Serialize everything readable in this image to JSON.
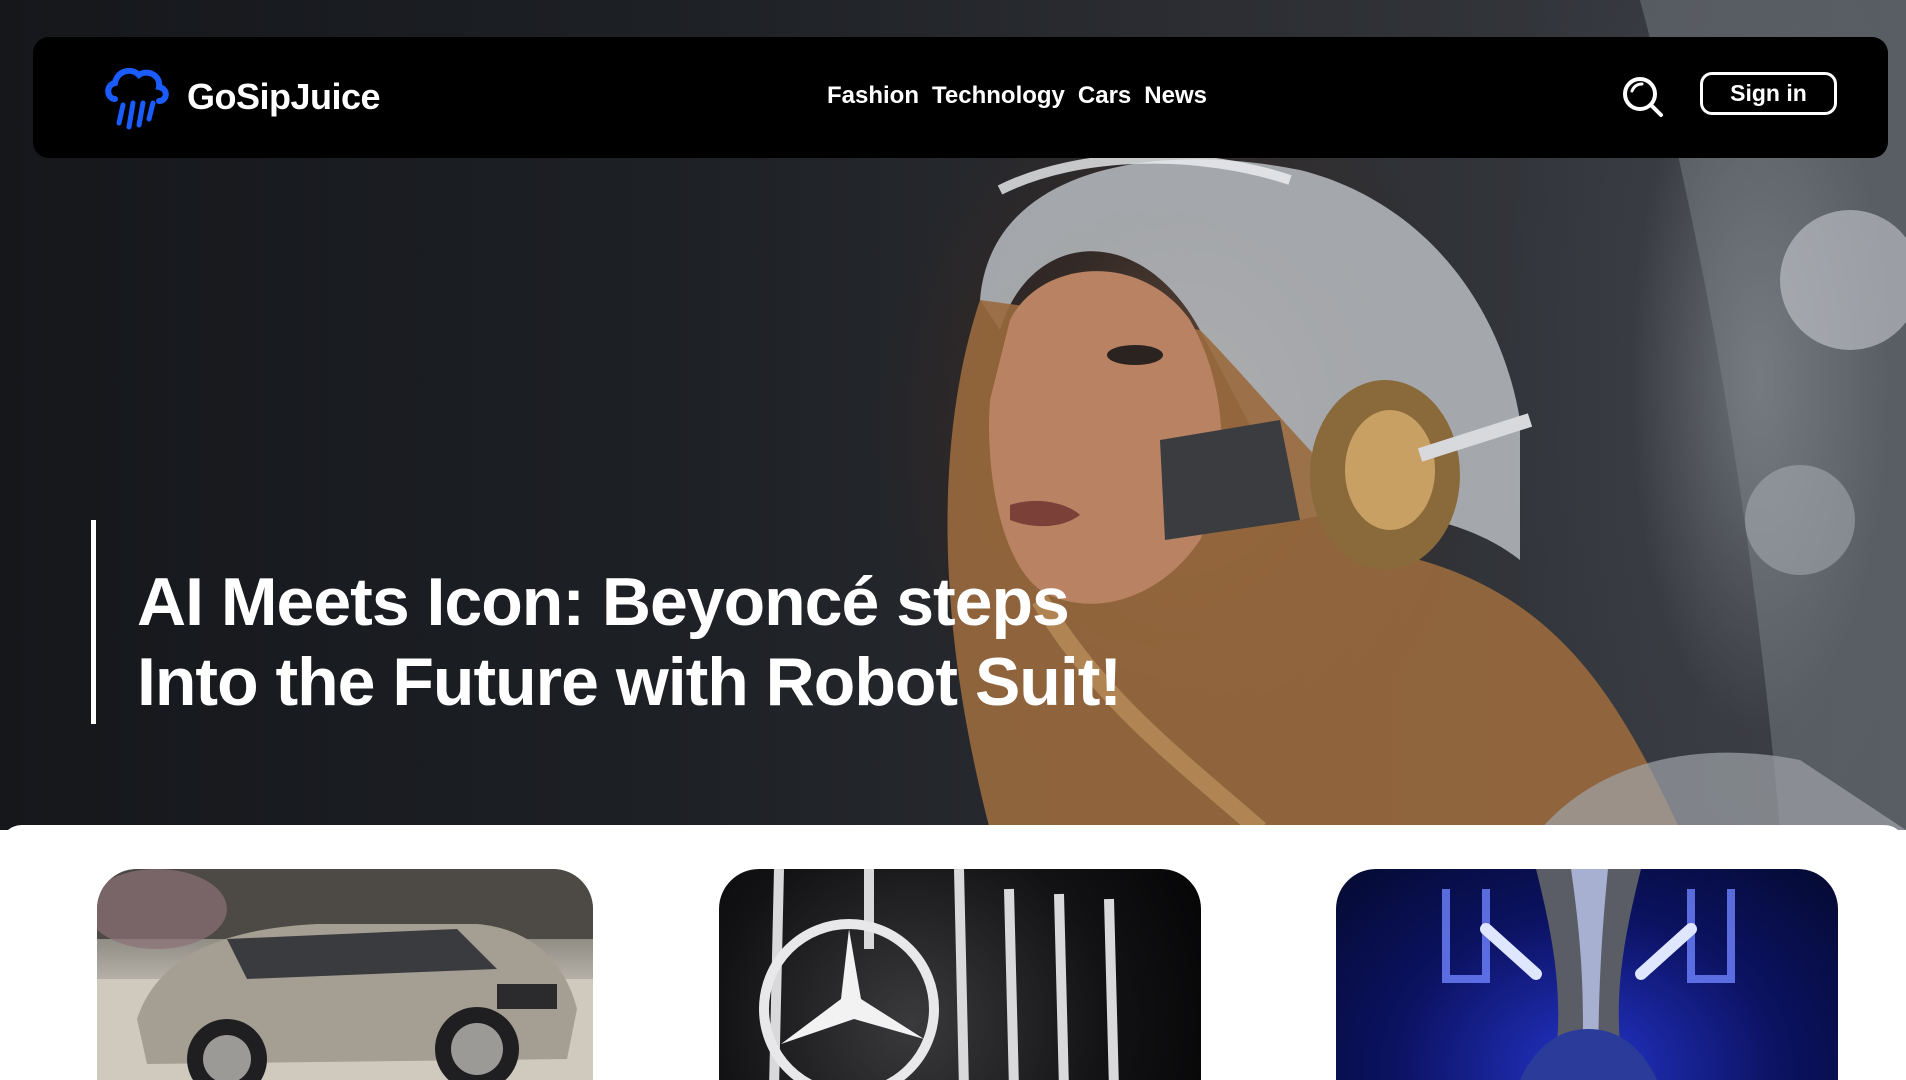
{
  "brand": {
    "name": "GoSipJuice",
    "logo_icon": "cloud-rain-icon",
    "accent_color": "#1a5cff"
  },
  "nav": {
    "links": [
      "Fashion",
      "Technology",
      "Cars",
      "News"
    ],
    "search_icon": "search-icon",
    "signin_label": "Sign in"
  },
  "hero": {
    "headline_line1": "AI Meets Icon: Beyoncé steps",
    "headline_line2": "Into the Future with Robot Suit!"
  },
  "cards": [
    {
      "image": "suv-car"
    },
    {
      "image": "mercedes-grille"
    },
    {
      "image": "chrome-figure-neon"
    }
  ]
}
